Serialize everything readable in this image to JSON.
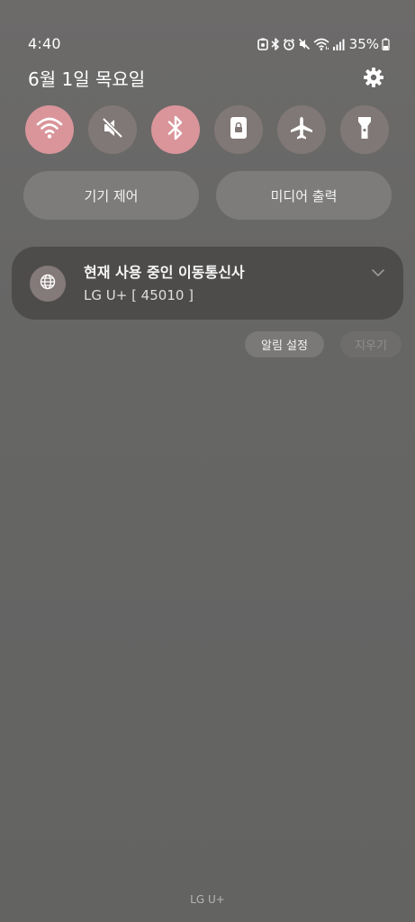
{
  "status_bar": {
    "time": "4:40",
    "battery_percent": "35%",
    "icons": [
      "screenshot-icon",
      "bluetooth-icon",
      "alarm-icon",
      "mute-icon",
      "wifi-icon",
      "signal-icon",
      "battery-icon"
    ]
  },
  "header": {
    "date": "6월 1일 목요일",
    "settings_icon": "gear-icon"
  },
  "quick_settings": {
    "tiles": [
      {
        "icon": "wifi-icon",
        "state": "on"
      },
      {
        "icon": "sound-mute-icon",
        "state": "off"
      },
      {
        "icon": "bluetooth-icon",
        "state": "on"
      },
      {
        "icon": "portrait-lock-icon",
        "state": "off"
      },
      {
        "icon": "airplane-icon",
        "state": "off"
      },
      {
        "icon": "flashlight-icon",
        "state": "off"
      }
    ],
    "on_color": "#d9959a",
    "off_color": "#807876"
  },
  "controls": {
    "device_control": "기기 제어",
    "media_output": "미디어 출력"
  },
  "notification": {
    "icon": "globe-icon",
    "title": "현재 사용 중인 이동통신사",
    "body": "LG U+ [ 45010 ]"
  },
  "actions": {
    "notification_settings": "알림 설정",
    "clear": "지우기"
  },
  "footer": {
    "carrier": "LG U+"
  }
}
